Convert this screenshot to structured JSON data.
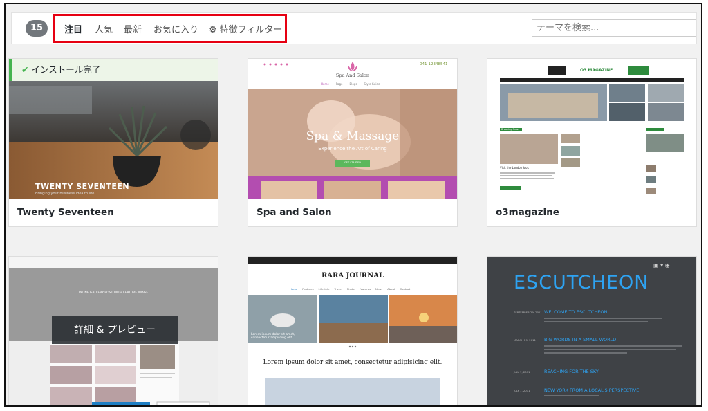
{
  "filter": {
    "count": "15",
    "tabs": [
      "注目",
      "人気",
      "最新",
      "お気に入り"
    ],
    "feature_filter": "特徴フィルター",
    "search_placeholder": "テーマを検索..."
  },
  "colors": {
    "highlight_box": "#e60012",
    "installed_green": "#46b450",
    "escutcheon_blue": "#2ea3f2"
  },
  "themes": [
    {
      "name": "Twenty Seventeen",
      "status": "インストール完了",
      "shot_title": "TWENTY SEVENTEEN",
      "shot_sub": "Bringing your business idea to life"
    },
    {
      "name": "Spa and Salon",
      "brand": "Spa And Salon",
      "phone": "041-12348541",
      "nav": [
        "Home",
        "Page",
        "Blogs",
        "Style Guide"
      ],
      "hero_title": "Spa & Massage",
      "hero_sub": "Experience the Art of Caring",
      "cta": "GET STARTED"
    },
    {
      "name": "o3magazine",
      "logo": "O3 MAGAZINE",
      "section1": "Breaking News",
      "section2": "Breaking News",
      "headline": "Visit the London look"
    },
    {
      "name": "",
      "overlay_button": "詳細 & プレビュー",
      "heading": "INLINE GALLERY POST WITH FEATURE IMAGE"
    },
    {
      "name": "",
      "title": "RARA JOURNAL",
      "nav": [
        "Home",
        "Features",
        "Lifestyle",
        "Travel",
        "Photo",
        "Features",
        "News",
        "About",
        "Contact"
      ],
      "caption": "Lorem ipsum dolor sit amet, consectetur adipiscing elit",
      "article": "Lorem ipsum dolor sit amet, consectetur adipisicing elit."
    },
    {
      "name": "",
      "title": "ESCUTCHEON",
      "posts": [
        "WELCOME TO ESCUTCHEON",
        "BIG WORDS IN A SMALL WORLD",
        "REACHING FOR THE SKY",
        "NEW YORK FROM A LOCAL'S PERSPECTIVE"
      ],
      "dates": [
        "SEPTEMBER 29, 2011",
        "MARCH 29, 2011",
        "JULY 7, 2011",
        "JULY 1, 2011"
      ]
    }
  ]
}
